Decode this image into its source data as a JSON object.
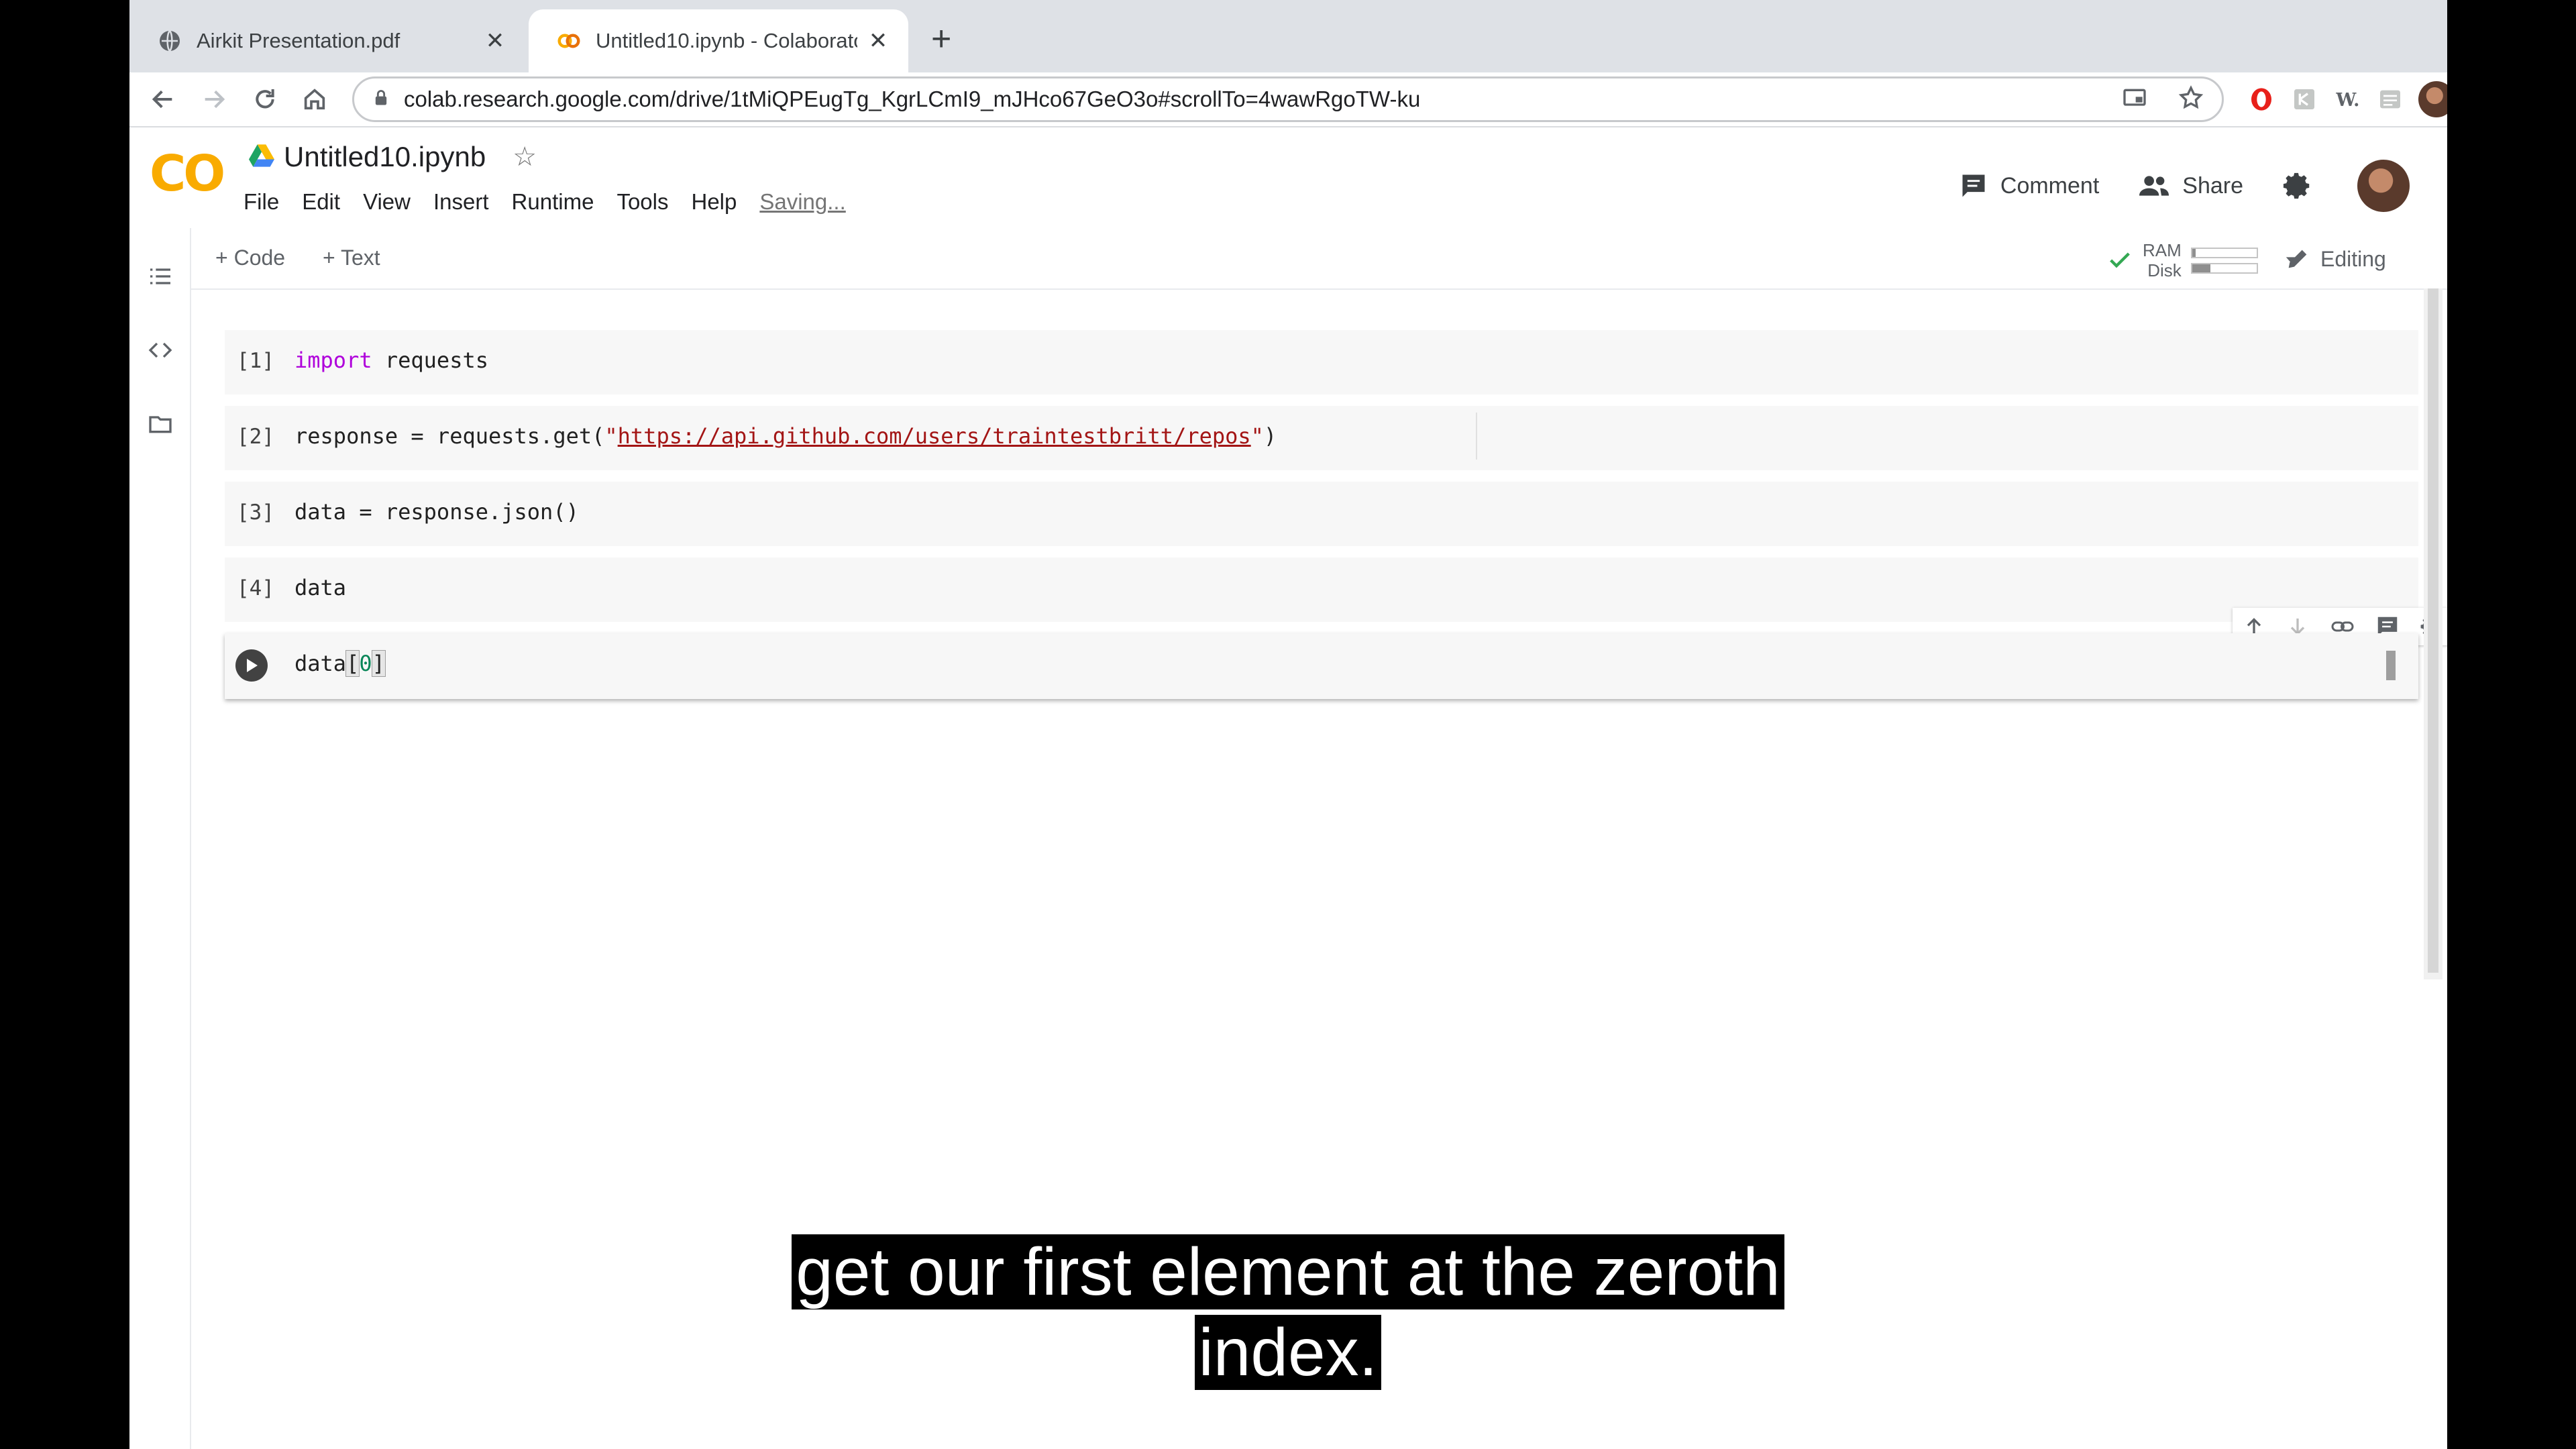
{
  "browser": {
    "tabs": [
      {
        "title": "Airkit Presentation.pdf",
        "favicon": "globe-icon",
        "active": false
      },
      {
        "title": "Untitled10.ipynb - Colaboratory",
        "favicon": "colab-icon",
        "active": true
      }
    ],
    "url": "colab.research.google.com/drive/1tMiQPEugTg_KgrLCmI9_mJHco67GeO3o#scrollTo=4wawRgoTW-ku"
  },
  "colab": {
    "logo_text": "CO",
    "notebook_title": "Untitled10.ipynb",
    "menu": [
      "File",
      "Edit",
      "View",
      "Insert",
      "Runtime",
      "Tools",
      "Help"
    ],
    "save_status": "Saving...",
    "comment_label": "Comment",
    "share_label": "Share",
    "add_code_label": "+ Code",
    "add_text_label": "+ Text",
    "ram_label": "RAM",
    "disk_label": "Disk",
    "ram_usage": 0.05,
    "disk_usage": 0.28,
    "editing_label": "Editing",
    "accent_color": "#f9ab00"
  },
  "cells": [
    {
      "number": "[1]",
      "keyword": "import",
      "code": " requests"
    },
    {
      "number": "[2]",
      "prefix": "response = requests.get(",
      "quote_open": "\"",
      "string": "https://api.github.com/users/traintestbritt/repos",
      "quote_close": "\"",
      "suffix": ")"
    },
    {
      "number": "[3]",
      "code": "data = response.json()"
    },
    {
      "number": "[4]",
      "code": "data"
    },
    {
      "code_prefix": "data",
      "open_bracket": "[",
      "index": "0",
      "close_bracket": "]"
    }
  ],
  "caption": {
    "line1": "get our first element at the zeroth",
    "line2": "index."
  }
}
